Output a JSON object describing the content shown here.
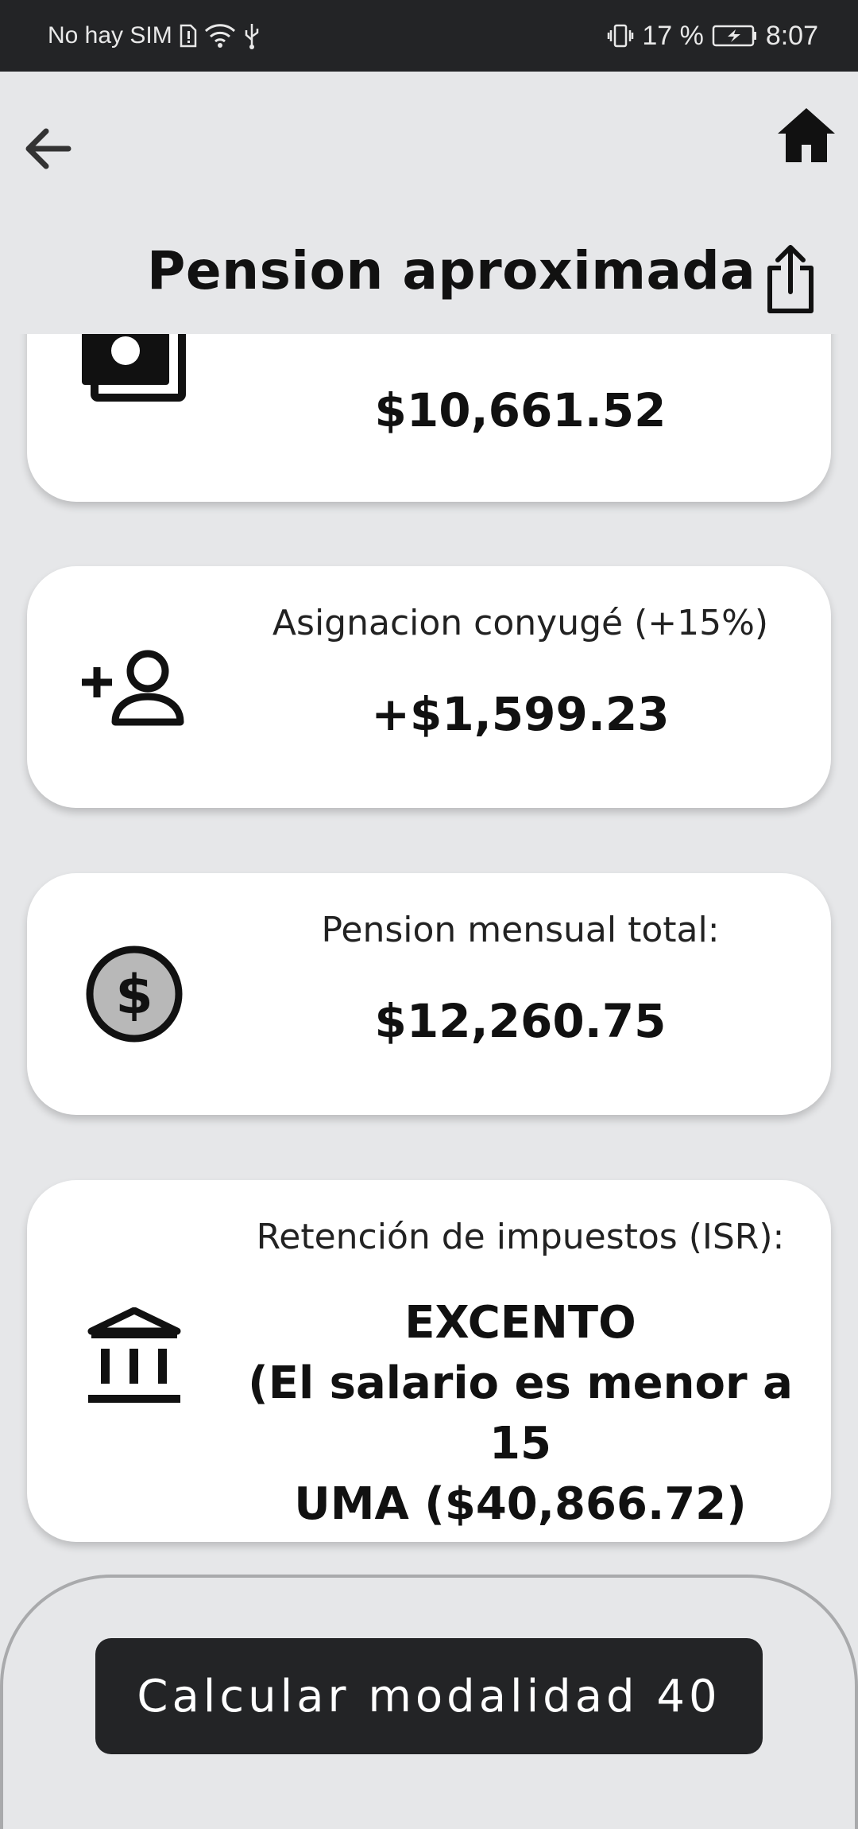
{
  "status_bar": {
    "carrier": "No hay SIM",
    "battery_percent": "17 %",
    "time": "8:07"
  },
  "header": {
    "title": "Pension aproximada",
    "back_icon": "arrow-back-icon",
    "home_icon": "home-icon",
    "share_icon": "share-icon"
  },
  "cards": [
    {
      "icon": "money-icon",
      "label": "",
      "value": "$10,661.52"
    },
    {
      "icon": "person-add-icon",
      "label": "Asignacion conyugé (+15%)",
      "value": "+$1,599.23"
    },
    {
      "icon": "dollar-circle-icon",
      "label": "Pension mensual total:",
      "value": "$12,260.75"
    },
    {
      "icon": "bank-icon",
      "label": "Retención de impuestos (ISR):",
      "value_lines": [
        "EXCENTO",
        "(El salario es menor a 15",
        "UMA ($40,866.72)"
      ]
    }
  ],
  "footer": {
    "button_label": "Calcular modalidad 40"
  },
  "colors": {
    "background": "#e6e7e9",
    "status_bar": "#232426",
    "card": "#ffffff",
    "button": "#232426"
  }
}
